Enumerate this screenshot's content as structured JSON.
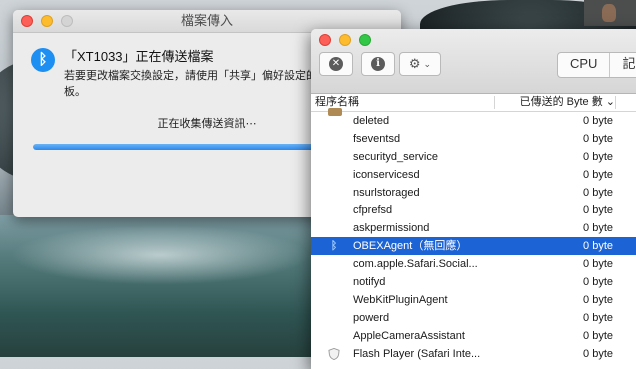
{
  "file_transfer": {
    "window_title": "檔案傳入",
    "heading": "「XT1033」正在傳送檔案",
    "description": "若要更改檔案交換設定，請使用「共享」偏好設定的「藍芽共享」面板。",
    "status": "正在收集傳送資訊⋯",
    "progress_fraction": 0.8,
    "bluetooth_icon": "bluetooth-icon"
  },
  "activity_monitor": {
    "tabs": [
      "CPU",
      "記憶體"
    ],
    "columns": {
      "name": "程序名稱",
      "bytes": "已傳送的 Byte 數 ⌄"
    },
    "rows": [
      {
        "name": "deleted",
        "bytes": "0 byte",
        "icon": ""
      },
      {
        "name": "fseventsd",
        "bytes": "0 byte",
        "icon": ""
      },
      {
        "name": "securityd_service",
        "bytes": "0 byte",
        "icon": ""
      },
      {
        "name": "iconservicesd",
        "bytes": "0 byte",
        "icon": ""
      },
      {
        "name": "nsurlstoraged",
        "bytes": "0 byte",
        "icon": ""
      },
      {
        "name": "cfprefsd",
        "bytes": "0 byte",
        "icon": ""
      },
      {
        "name": "askpermissiond",
        "bytes": "0 byte",
        "icon": ""
      },
      {
        "name": "OBEXAgent（無回應）",
        "bytes": "0 byte",
        "icon": "bluetooth-icon",
        "selected": true
      },
      {
        "name": "com.apple.Safari.Social...",
        "bytes": "0 byte",
        "icon": ""
      },
      {
        "name": "notifyd",
        "bytes": "0 byte",
        "icon": ""
      },
      {
        "name": "WebKitPluginAgent",
        "bytes": "0 byte",
        "icon": ""
      },
      {
        "name": "powerd",
        "bytes": "0 byte",
        "icon": ""
      },
      {
        "name": "AppleCameraAssistant",
        "bytes": "0 byte",
        "icon": ""
      },
      {
        "name": "Flash Player (Safari Inte...",
        "bytes": "0 byte",
        "icon": "shield-icon"
      }
    ]
  }
}
